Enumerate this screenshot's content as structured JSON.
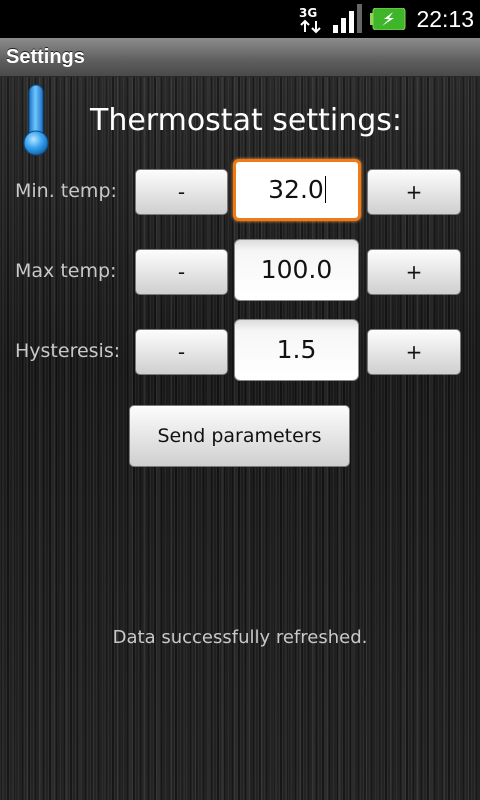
{
  "status_bar": {
    "network_type": "3G",
    "time": "22:13",
    "icons": [
      "3g-data-icon",
      "signal-strength-icon",
      "battery-charging-icon"
    ],
    "battery_color": "#3fb62a"
  },
  "title_bar": {
    "title": "Settings"
  },
  "main": {
    "heading": "Thermostat settings:",
    "icon": "thermometer-icon",
    "rows": [
      {
        "label": "Min. temp:",
        "minus": "-",
        "value": "32.0",
        "plus": "+",
        "focused": true
      },
      {
        "label": "Max temp:",
        "minus": "-",
        "value": "100.0",
        "plus": "+",
        "focused": false
      },
      {
        "label": "Hysteresis:",
        "minus": "-",
        "value": "1.5",
        "plus": "+",
        "focused": false
      }
    ],
    "send_button": "Send parameters",
    "status_message": "Data successfully refreshed."
  },
  "colors": {
    "focus_accent": "#f07a16",
    "thermometer": "#2f9be8"
  }
}
